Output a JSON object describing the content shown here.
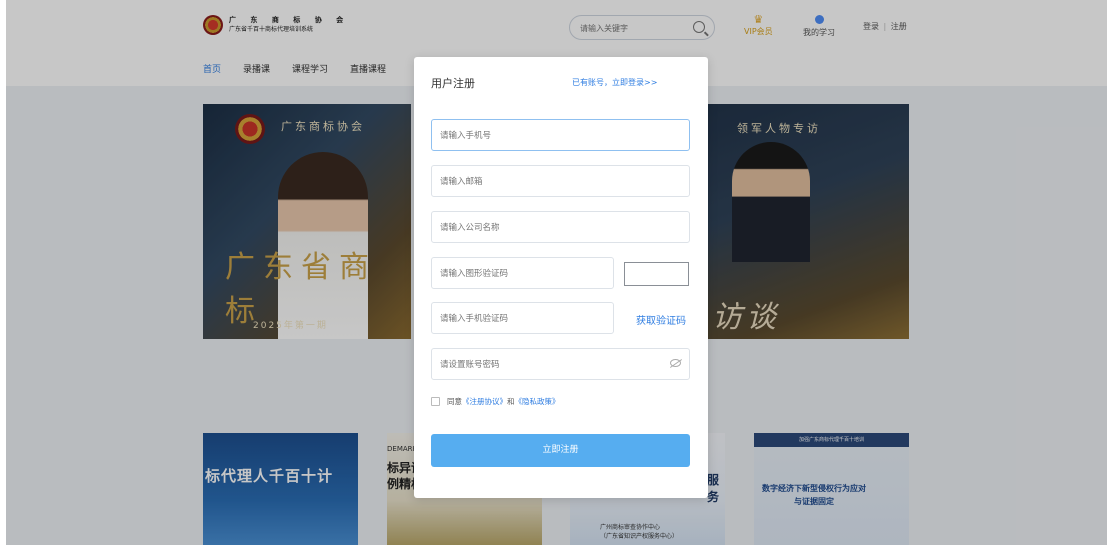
{
  "header": {
    "logo_line1": "广 东 商 标 协 会",
    "logo_line2": "广东省千百十商标代理培训系统",
    "search_placeholder": "请输入关键字",
    "vip_label": "VIP会员",
    "my_learning_label": "我的学习",
    "login_label": "登录",
    "divider": "|",
    "register_label": "注册"
  },
  "nav": [
    "首页",
    "录播课",
    "课程学习",
    "直播课程"
  ],
  "banners": {
    "left": {
      "association": "广东商标协会",
      "big_text": "广东省商标",
      "issue": "2025年第一期"
    },
    "right": {
      "title": "领军人物专访",
      "big_text": "访谈"
    }
  },
  "cards": {
    "card1_title": "标代理人千百十计",
    "card2_line1": "DEMARK",
    "card2_line2": "标异议",
    "card2_line3": "例精析",
    "card3_title": "服务",
    "card3_sub1": "广州商标审查协作中心",
    "card3_sub2": "（广东省知识产权服务中心）",
    "card4_header": "加强广东商标代理千百十培训",
    "card4_line1": "数字经济下新型侵权行为应对",
    "card4_line2": "与证据固定"
  },
  "modal": {
    "title": "用户注册",
    "login_link": "已有账号，立即登录>>",
    "phone_placeholder": "请输入手机号",
    "email_placeholder": "请输入邮箱",
    "company_placeholder": "请输入公司名称",
    "captcha_placeholder": "请输入图形验证码",
    "sms_placeholder": "请输入手机验证码",
    "get_code_label": "获取验证码",
    "password_placeholder": "请设置账号密码",
    "agree_prefix": "同意",
    "agreement_link": "《注册协议》",
    "agree_and": "和",
    "privacy_link": "《隐私政策》",
    "submit_label": "立即注册"
  },
  "colors": {
    "accent": "#2f7de1",
    "submit_bg": "#56adf0",
    "vip": "#d9a21d"
  }
}
